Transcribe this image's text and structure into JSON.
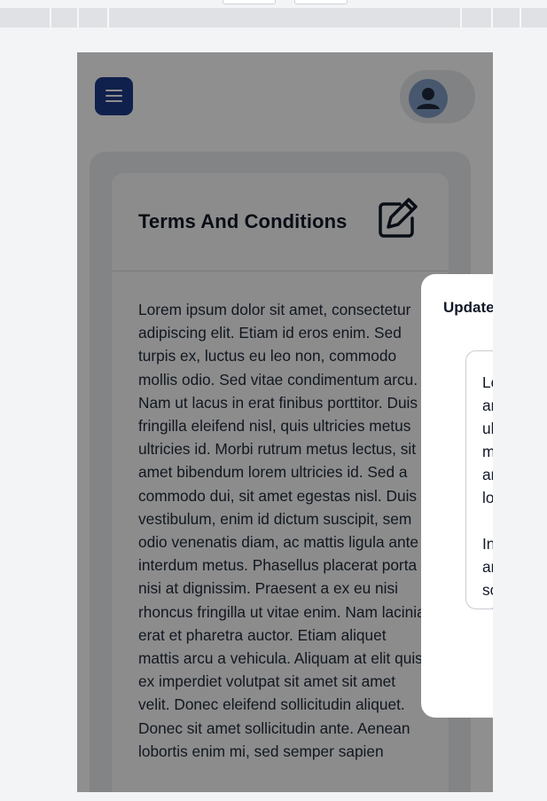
{
  "page": {
    "title": "Terms And Conditions",
    "body": "Lorem ipsum dolor sit amet, consectetur adipiscing elit. Etiam id eros enim. Sed turpis ex, luctus eu leo non, commodo mollis odio. Sed vitae condimentum arcu. Nam ut lacus in erat finibus porttitor. Duis fringilla eleifend nisl, quis ultricies metus ultricies id. Morbi rutrum metus lectus, sit amet bibendum lorem ultricies id. Sed a commodo dui, sit amet egestas nisl. Duis vestibulum, enim id dictum suscipit, sem odio venenatis diam, ac mattis ligula ante interdum metus. Phasellus placerat porta nisi at dignissim. Praesent a ex eu nisi rhoncus fringilla ut vitae enim. Nam lacinia erat et pharetra auctor. Etiam aliquet mattis arcu a vehicula. Aliquam at elit quis ex imperdiet volutpat sit amet sit amet velit. Donec eleifend sollicitudin aliquet. Donec sit amet sollicitudin ante. Aenean lobortis enim mi, sed semper sapien"
  },
  "modal": {
    "title": "Update",
    "text_visible": "Lo\nar\nul\nm\nar\nlo\n\nIn\nar\nsc\net"
  },
  "icons": {
    "menu": "hamburger-menu-icon",
    "profile": "user-avatar-icon",
    "edit": "pencil-square-icon"
  },
  "colors": {
    "primary": "#1e3a8a",
    "overlay": "rgba(0,0,0,0.44)"
  }
}
